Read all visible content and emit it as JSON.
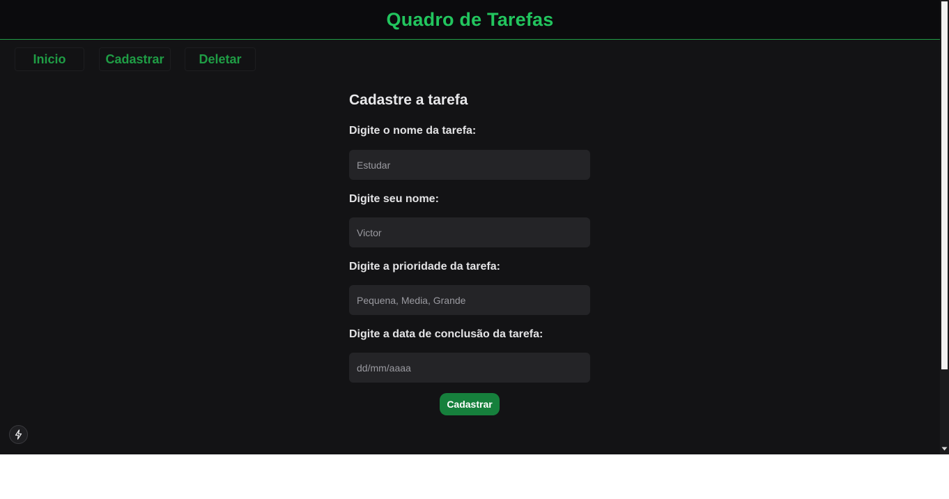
{
  "header": {
    "title": "Quadro de Tarefas"
  },
  "nav": {
    "items": [
      {
        "label": "Inicio"
      },
      {
        "label": "Cadastrar"
      },
      {
        "label": "Deletar"
      }
    ]
  },
  "form": {
    "title": "Cadastre a tarefa",
    "fields": [
      {
        "label": "Digite o nome da tarefa:",
        "placeholder": "Estudar"
      },
      {
        "label": "Digite seu nome:",
        "placeholder": "Victor"
      },
      {
        "label": "Digite a prioridade da tarefa:",
        "placeholder": "Pequena, Media, Grande"
      },
      {
        "label": "Digite a data de conclusão da tarefa:",
        "placeholder": "dd/mm/aaaa"
      }
    ],
    "submit_label": "Cadastrar"
  },
  "icons": {
    "dev_indicator": "lightning-icon",
    "scroll_down": "chevron-down-icon"
  },
  "colors": {
    "accent": "#22c55e",
    "nav_text": "#1f9d45",
    "button_bg": "#16803c",
    "background": "#131315",
    "input_bg": "#242427"
  }
}
